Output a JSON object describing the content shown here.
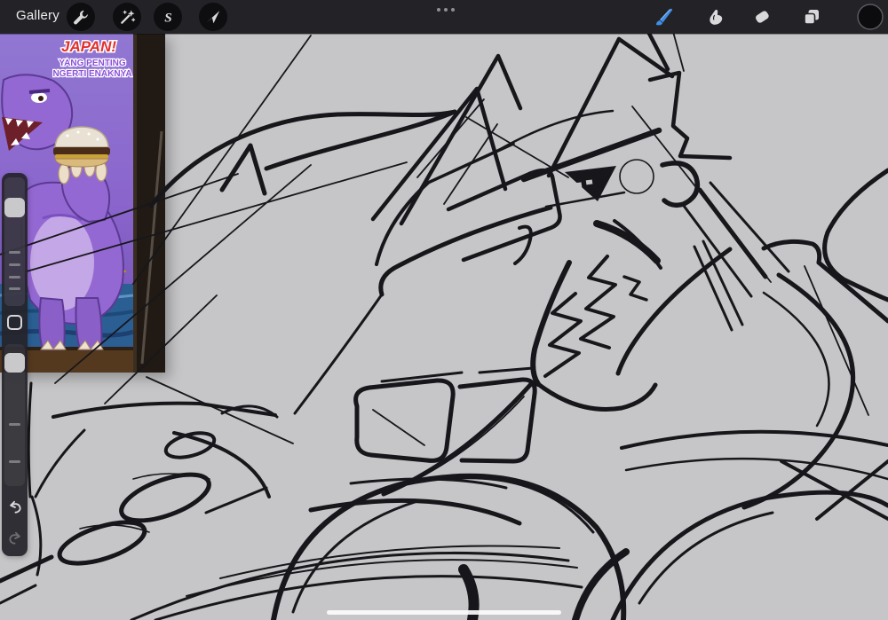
{
  "toolbar": {
    "gallery_label": "Gallery",
    "accent_color": "#3e8de8",
    "current_color": "#0c0c0e",
    "left_tools": [
      {
        "name": "actions",
        "icon": "wrench-icon"
      },
      {
        "name": "adjustments",
        "icon": "magic-wand-icon"
      },
      {
        "name": "selection",
        "icon": "selection-s-icon"
      },
      {
        "name": "transform",
        "icon": "transform-arrow-icon"
      }
    ],
    "right_tools": [
      {
        "name": "paint",
        "icon": "paintbrush-icon",
        "active": true
      },
      {
        "name": "smudge",
        "icon": "smudge-finger-icon",
        "active": false
      },
      {
        "name": "erase",
        "icon": "eraser-icon",
        "active": false
      },
      {
        "name": "layers",
        "icon": "layers-icon",
        "active": false
      },
      {
        "name": "color",
        "icon": "color-swatch-circle",
        "active": false
      }
    ],
    "multitask_indicator": "three-dots"
  },
  "sidebar": {
    "size_slider": {
      "name": "brush-size-slider"
    },
    "opacity_slider": {
      "name": "brush-opacity-slider"
    },
    "modify_button": {
      "name": "modify-button"
    },
    "undo_button": {
      "name": "undo"
    },
    "redo_button": {
      "name": "redo"
    }
  },
  "canvas": {
    "background_color": "#c6c6c8",
    "ink_color": "#17171b",
    "artwork_subject": "monochrome line sketch of a roaring fanged dragon bust",
    "reference_card": {
      "title": "JAPAN!",
      "subtitle_line1": "YANG PENTING",
      "subtitle_line2": "NGERTI ENAKNYA",
      "title_color": "#e22f2f",
      "subtitle_color": "#8a4fd8"
    }
  },
  "system": {
    "home_indicator": "handle"
  }
}
